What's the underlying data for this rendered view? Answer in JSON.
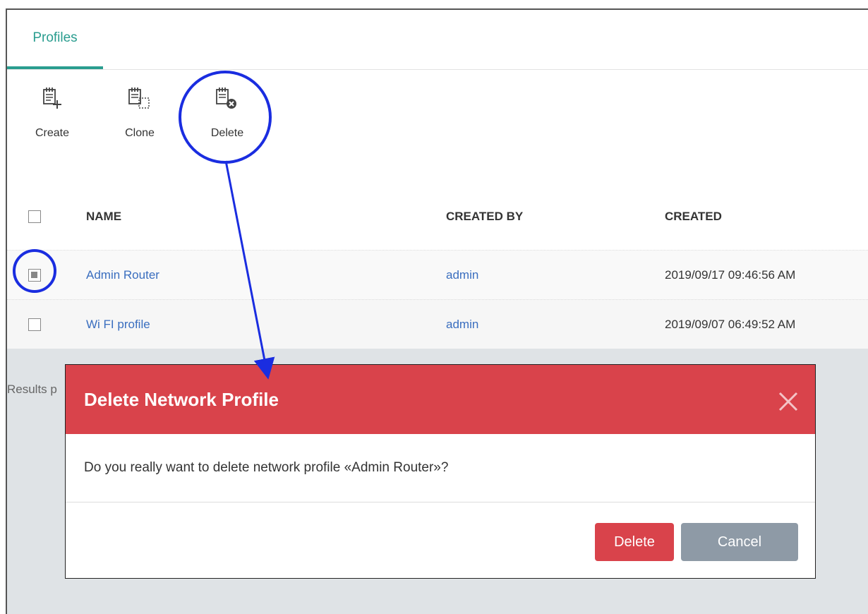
{
  "tabs": [
    {
      "label": "Profiles",
      "active": true
    }
  ],
  "toolbar": {
    "create_label": "Create",
    "clone_label": "Clone",
    "delete_label": "Delete"
  },
  "table": {
    "columns": [
      "NAME",
      "CREATED BY",
      "CREATED"
    ],
    "rows": [
      {
        "name": "Admin Router",
        "created_by": "admin",
        "created": "2019/09/17 09:46:56 AM",
        "checked": true
      },
      {
        "name": "Wi FI profile",
        "created_by": "admin",
        "created": "2019/09/07 06:49:52 AM",
        "checked": false
      }
    ]
  },
  "footer": {
    "results_label": "Results p"
  },
  "modal": {
    "title": "Delete Network Profile",
    "message": "Do you really want to delete network profile «Admin Router»?",
    "delete_label": "Delete",
    "cancel_label": "Cancel"
  },
  "colors": {
    "accent": "#2a9d8f",
    "danger": "#d9434b",
    "link": "#3a6ebf",
    "annotation": "#1a2de0",
    "cancel": "#8e9aa6"
  },
  "icons": [
    "create-profile-icon",
    "clone-profile-icon",
    "delete-profile-icon",
    "close-icon"
  ]
}
